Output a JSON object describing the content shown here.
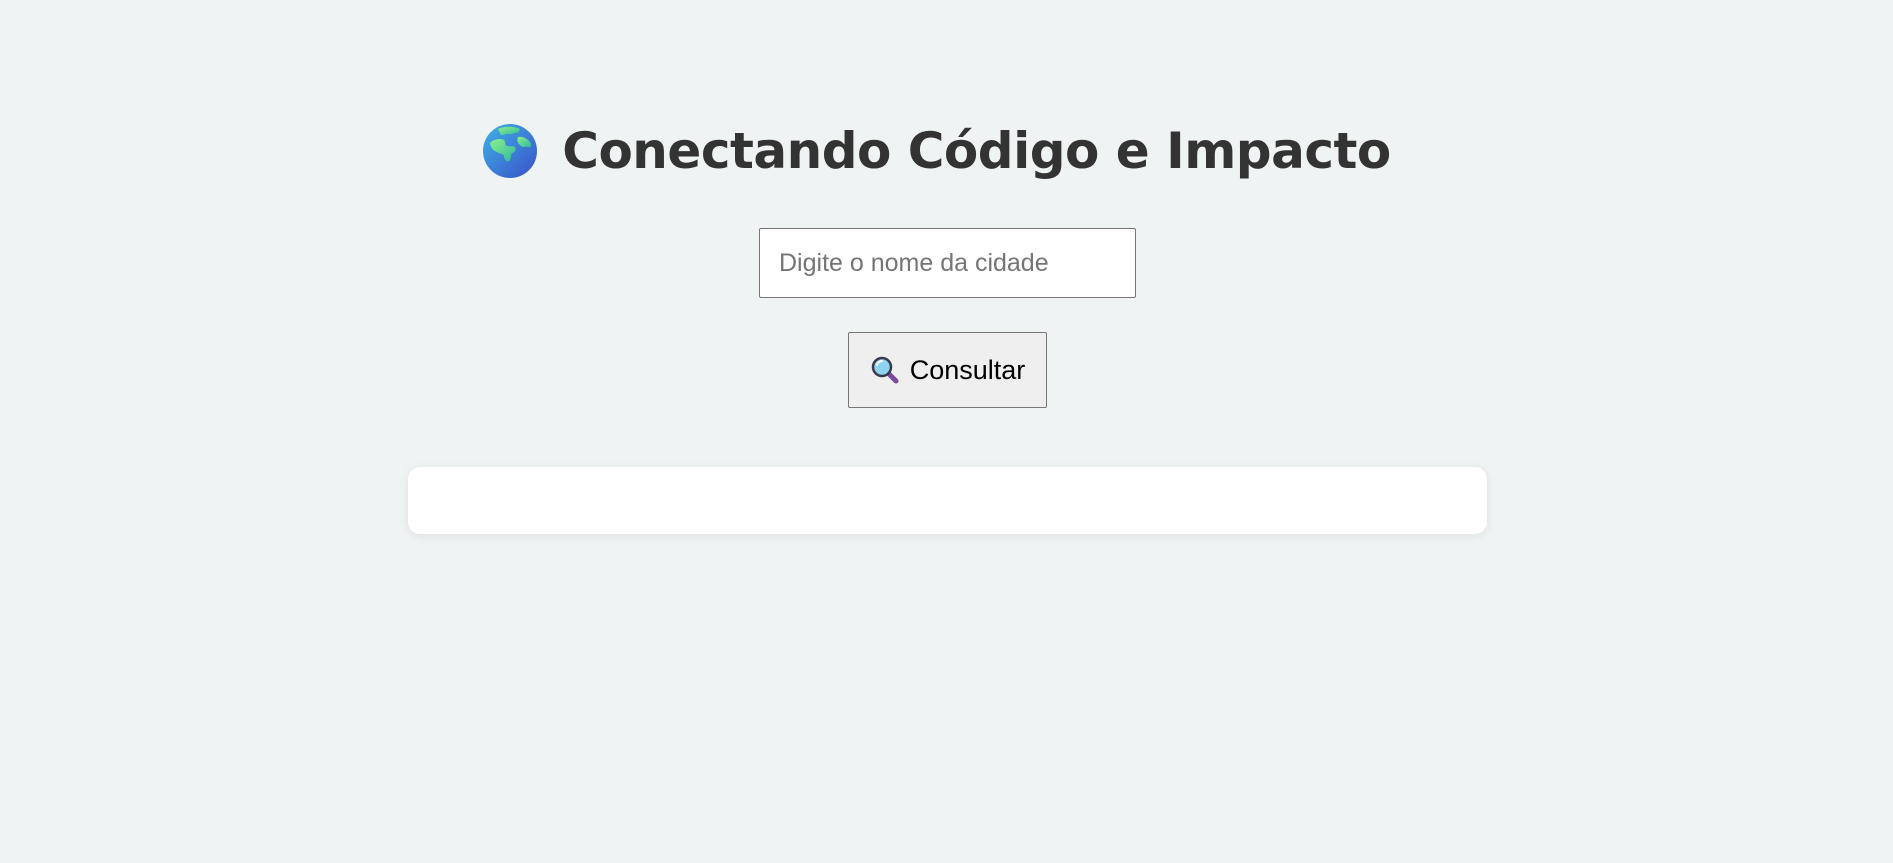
{
  "header": {
    "icon": "globe-icon",
    "title": "Conectando Código e Impacto"
  },
  "search": {
    "value": "",
    "placeholder": "Digite o nome da cidade"
  },
  "consult_button": {
    "icon": "magnifier-icon",
    "label": "Consultar"
  },
  "result": {
    "text": ""
  },
  "colors": {
    "background": "#f0f3f3",
    "title": "#333333",
    "card": "#ffffff",
    "button": "#efefef"
  }
}
